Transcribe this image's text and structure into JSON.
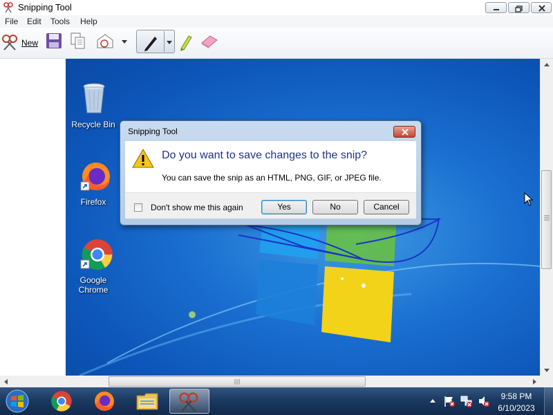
{
  "window": {
    "title": "Snipping Tool",
    "controls": {
      "minimize_icon": "minimize-icon",
      "maximize_icon": "maximize-icon",
      "close_icon": "close-icon"
    }
  },
  "menu": [
    "File",
    "Edit",
    "Tools",
    "Help"
  ],
  "toolbar": {
    "new_label": "New",
    "icons": [
      "new-snip-icon",
      "save-icon",
      "copy-icon",
      "send-snip-icon",
      "dropdown-arrow-icon",
      "pen-icon",
      "pen-dropdown-icon",
      "highlighter-icon",
      "eraser-icon"
    ]
  },
  "desktop": {
    "icons": [
      {
        "label": "Recycle Bin",
        "icon": "recycle-bin-icon"
      },
      {
        "label": "Firefox",
        "icon": "firefox-icon"
      },
      {
        "label": "Google Chrome",
        "icon": "chrome-icon"
      }
    ]
  },
  "dialog": {
    "title": "Snipping Tool",
    "heading": "Do you want to save changes to the snip?",
    "message": "You can save the snip as an HTML, PNG, GIF, or JPEG file.",
    "checkbox_label": "Don't show me this again",
    "checkbox_checked": false,
    "buttons": {
      "yes": "Yes",
      "no": "No",
      "cancel": "Cancel"
    },
    "default_button": "yes"
  },
  "taskbar": {
    "apps": [
      "start-icon",
      "chrome-icon",
      "firefox-icon",
      "explorer-icon",
      "snipping-tool-icon"
    ],
    "active_app": "snipping-tool-icon",
    "tray_icons": [
      "show-hidden-icons-icon",
      "action-center-flag-icon",
      "network-icon",
      "volume-muted-icon"
    ],
    "time": "9:58 PM",
    "date": "6/10/2023"
  },
  "colors": {
    "dialog_heading": "#1e3287",
    "taskbar": "#1b3a62",
    "desktop": "#1a6fd0"
  }
}
